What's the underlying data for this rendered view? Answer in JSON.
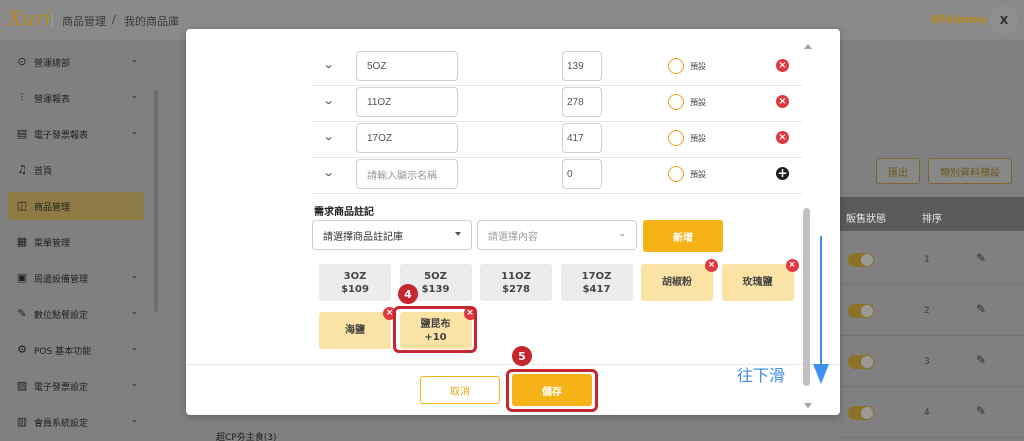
{
  "app": {
    "logo": "Xuri",
    "breadcrumb": [
      "商品管理",
      "/",
      "我的商品庫"
    ],
    "user": "XFkimmy",
    "avatar_letter": "X"
  },
  "sidebar": {
    "items": [
      {
        "label": "營運總部",
        "icon": "target-icon",
        "glyph": "⊙",
        "chevron": true
      },
      {
        "label": "營運報表",
        "icon": "chart-icon",
        "glyph": "⫶",
        "chevron": true
      },
      {
        "label": "電子發票報表",
        "icon": "document-icon",
        "glyph": "▤",
        "chevron": true
      },
      {
        "label": "首頁",
        "icon": "bell-icon",
        "glyph": "♫",
        "chevron": false
      },
      {
        "label": "商品管理",
        "icon": "bag-icon",
        "glyph": "◫",
        "chevron": false,
        "active": true
      },
      {
        "label": "菜單管理",
        "icon": "grid-icon",
        "glyph": "▦",
        "chevron": false
      },
      {
        "label": "周邊設備管理",
        "icon": "printer-icon",
        "glyph": "▣",
        "chevron": true
      },
      {
        "label": "數位點餐設定",
        "icon": "edit-icon",
        "glyph": "✎",
        "chevron": true
      },
      {
        "label": "POS 基本功能",
        "icon": "gear-icon",
        "glyph": "⚙",
        "chevron": true
      },
      {
        "label": "電子發票設定",
        "icon": "invoice-icon",
        "glyph": "▧",
        "chevron": true
      },
      {
        "label": "會員系統設定",
        "icon": "card-icon",
        "glyph": "▥",
        "chevron": true
      }
    ]
  },
  "background": {
    "buttons": {
      "export": "匯出",
      "category_default": "類別資料預設"
    },
    "table_headers": {
      "status": "販售狀態",
      "order": "排序"
    },
    "rows": [
      "1",
      "2",
      "3",
      "4"
    ],
    "bottom_text": "超CP夯主食(3)"
  },
  "modal": {
    "options": [
      {
        "name": "5OZ",
        "price": "139",
        "default_label": "預設",
        "action": "delete"
      },
      {
        "name": "11OZ",
        "price": "278",
        "default_label": "預設",
        "action": "delete"
      },
      {
        "name": "17OZ",
        "price": "417",
        "default_label": "預設",
        "action": "delete"
      },
      {
        "name": "",
        "placeholder": "請輸入顯示名稱",
        "price": "0",
        "default_label": "預設",
        "action": "add"
      }
    ],
    "notes_section": {
      "title": "需求商品註記",
      "library_select": "請選擇商品註記庫",
      "content_placeholder": "請選擇內容",
      "add_button": "新增"
    },
    "chips_row1": [
      {
        "line1": "3OZ",
        "line2": "$109",
        "style": "grey",
        "removable": false
      },
      {
        "line1": "5OZ",
        "line2": "$139",
        "style": "grey",
        "removable": false
      },
      {
        "line1": "11OZ",
        "line2": "$278",
        "style": "grey",
        "removable": false
      },
      {
        "line1": "17OZ",
        "line2": "$417",
        "style": "grey",
        "removable": false
      },
      {
        "line1": "胡椒粉",
        "line2": "",
        "style": "yellow",
        "removable": true
      },
      {
        "line1": "玫瑰鹽",
        "line2": "",
        "style": "yellow",
        "removable": true
      }
    ],
    "chips_row2": [
      {
        "line1": "海鹽",
        "line2": "",
        "style": "yellow",
        "removable": true
      },
      {
        "line1": "鹽昆布",
        "line2": "+10",
        "style": "yellow",
        "removable": true
      }
    ],
    "footer": {
      "cancel": "取消",
      "save": "儲存"
    }
  },
  "annotations": {
    "step4": "4",
    "step5": "5",
    "scroll_hint": "往下滑",
    "highlight_color": "#c6262e",
    "accent": "#f6b318",
    "hint_color": "#3f8ff0"
  }
}
